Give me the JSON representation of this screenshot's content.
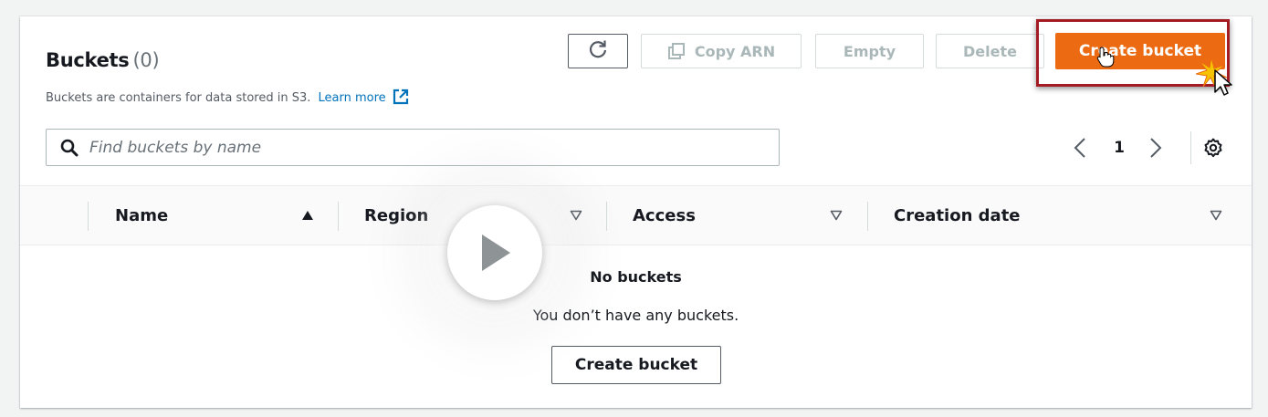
{
  "header": {
    "title": "Buckets",
    "count": "(0)",
    "description": "Buckets are containers for data stored in S3.",
    "learn_more": "Learn more"
  },
  "toolbar": {
    "refresh_icon": "refresh-icon",
    "copy_arn_label": "Copy ARN",
    "copy_icon": "copy-icon",
    "empty_label": "Empty",
    "delete_label": "Delete",
    "create_label": "Create bucket"
  },
  "search": {
    "placeholder": "Find buckets by name",
    "value": ""
  },
  "pagination": {
    "current_page": "1"
  },
  "table": {
    "columns": [
      {
        "label": "Name",
        "sort": "ascending"
      },
      {
        "label": "Region",
        "sort": "none"
      },
      {
        "label": "Access",
        "sort": "none"
      },
      {
        "label": "Creation date",
        "sort": "none"
      }
    ],
    "empty_title": "No buckets",
    "empty_description": "You don’t have any buckets.",
    "empty_action": "Create bucket"
  },
  "colors": {
    "primary_button": "#ec6b12",
    "highlight_frame": "#a31b23",
    "link": "#0073bb"
  }
}
